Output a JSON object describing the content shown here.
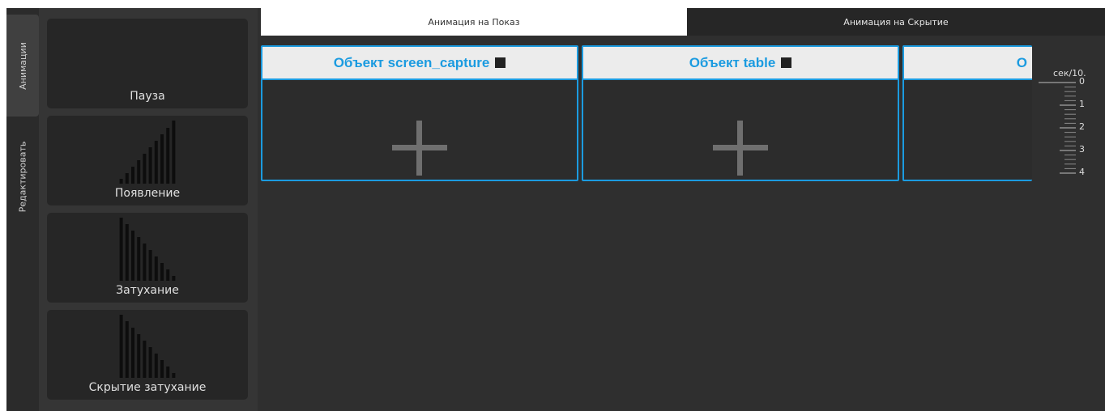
{
  "side_tabs": {
    "animations": "Анимации",
    "edit": "Редактировать"
  },
  "palette": {
    "items": [
      {
        "label": "Пауза",
        "icon": "pause-blank-icon"
      },
      {
        "label": "Появление",
        "icon": "ascending-bars-icon"
      },
      {
        "label": "Затухание",
        "icon": "descending-bars-icon"
      },
      {
        "label": "Скрытие затухание",
        "icon": "descending-bars-icon"
      }
    ]
  },
  "top_tabs": {
    "show": "Анимация на Показ",
    "hide": "Анимация на Скрытие"
  },
  "objects": [
    {
      "name": "Объект screen_capture"
    },
    {
      "name": "Объект table"
    },
    {
      "name": "О"
    }
  ],
  "ruler": {
    "unit": "сек/10.",
    "ticks": [
      "0",
      "1",
      "2",
      "3",
      "4"
    ]
  },
  "colors": {
    "accent": "#1b9be0",
    "background": "#303030",
    "card": "#262626"
  }
}
